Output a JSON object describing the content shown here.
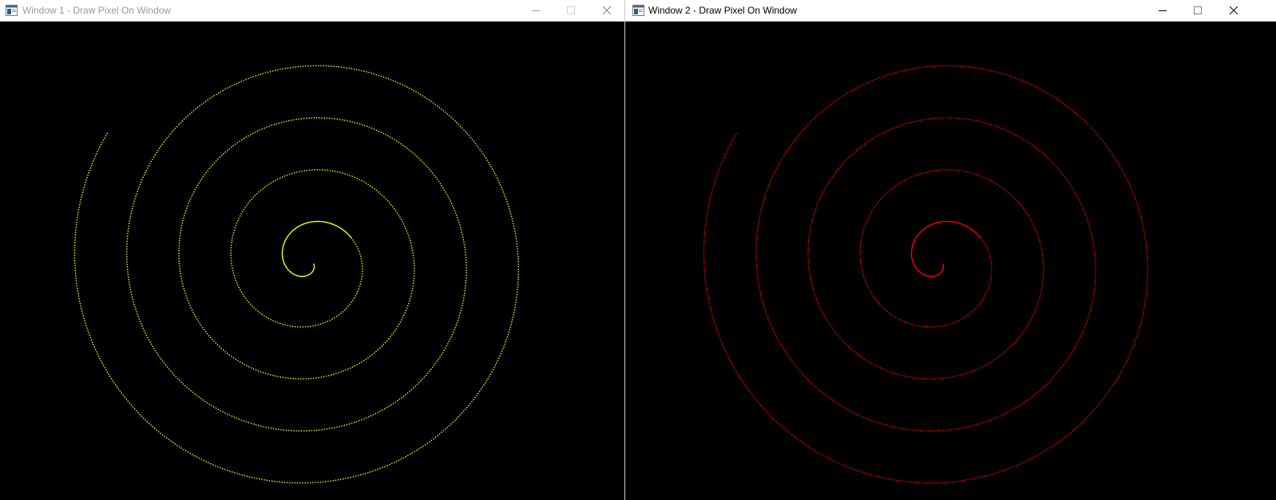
{
  "windows": [
    {
      "title": "Window 1 - Draw Pixel On Window",
      "pixel_color": "#ffff00",
      "active": false,
      "icons": [
        "app-icon",
        "minimize-icon",
        "maximize-icon",
        "close-icon"
      ]
    },
    {
      "title": "Window 2 - Draw Pixel On Window",
      "pixel_color": "#ff0000",
      "active": true,
      "icons": [
        "app-icon",
        "minimize-icon",
        "maximize-icon",
        "close-icon"
      ]
    }
  ],
  "colors": {
    "client_background": "#000000",
    "titlebar_background": "#ffffff",
    "inactive_title_text": "#9a9a9a",
    "active_title_text": "#000000"
  }
}
